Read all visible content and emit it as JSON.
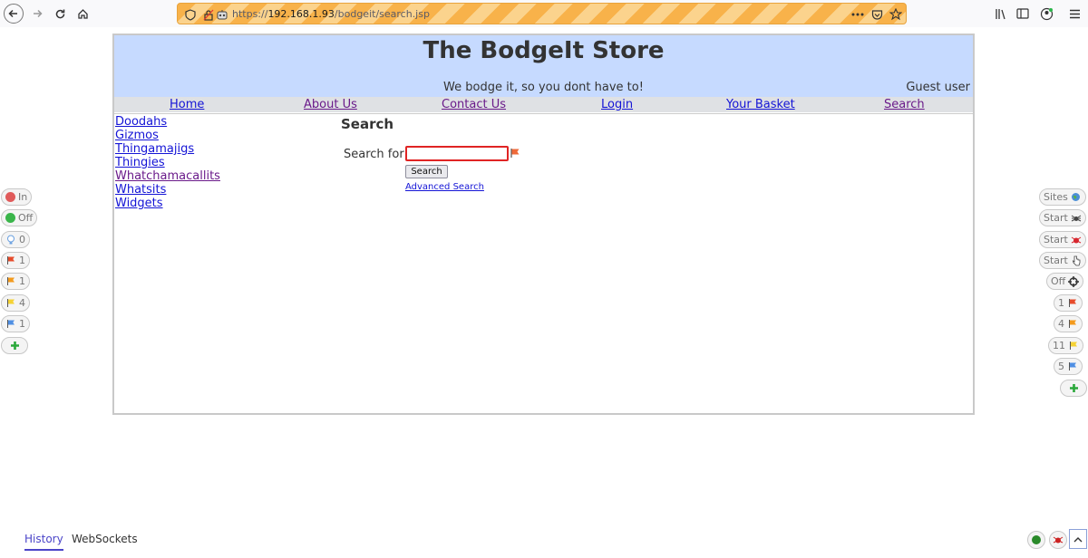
{
  "browser": {
    "url_scheme": "https://",
    "url_host": "192.168.1.93",
    "url_path": "/bodgeit/search.jsp"
  },
  "store": {
    "title": "The BodgeIt Store",
    "tagline": "We bodge it, so you dont have to!",
    "user": "Guest user",
    "menu": [
      "Home",
      "About Us",
      "Contact Us",
      "Login",
      "Your Basket",
      "Search"
    ],
    "categories": [
      "Doodahs",
      "Gizmos",
      "Thingamajigs",
      "Thingies",
      "Whatchamacallits",
      "Whatsits",
      "Widgets"
    ],
    "search": {
      "heading": "Search",
      "label": "Search for",
      "value": "",
      "button": "Search",
      "advanced": "Advanced Search"
    }
  },
  "zap_left": {
    "in_label": "In",
    "off_label": "Off",
    "hint_count": "0",
    "red_alerts": "1",
    "orange_alerts": "1",
    "yellow_alerts": "4",
    "blue_alerts": "1"
  },
  "zap_right": {
    "sites_label": "Sites",
    "spider_label": "Start",
    "active_scan_label": "Start",
    "ajax_label": "Start",
    "attack_label": "Off",
    "red_alerts": "1",
    "orange_alerts": "4",
    "yellow_alerts": "11",
    "blue_alerts": "5"
  },
  "bottom": {
    "tab_history": "History",
    "tab_websockets": "WebSockets"
  },
  "colors": {
    "header_bg": "#c6daff",
    "link": "#1414d6",
    "visited": "#6a1a8a",
    "url_stripe": "#f8b24a"
  }
}
